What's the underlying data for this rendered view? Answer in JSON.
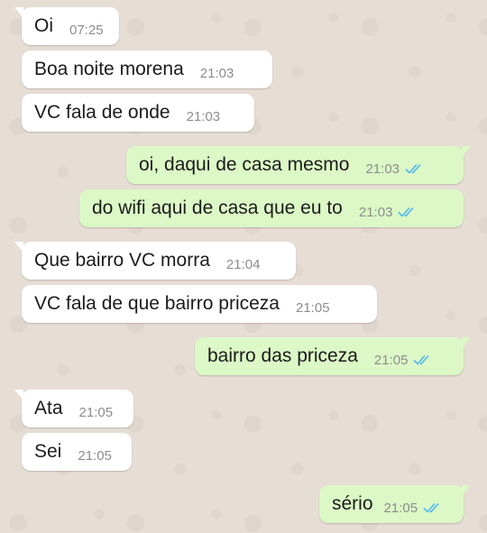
{
  "messages": [
    {
      "text": "Oi",
      "time": "07:25",
      "direction": "incoming"
    },
    {
      "text": "Boa noite morena",
      "time": "21:03",
      "direction": "incoming"
    },
    {
      "text": "VC fala de onde",
      "time": "21:03",
      "direction": "incoming"
    },
    {
      "text": "oi, daqui de casa mesmo",
      "time": "21:03",
      "direction": "outgoing",
      "status": "read"
    },
    {
      "text": "do wifi aqui de casa que eu to",
      "time": "21:03",
      "direction": "outgoing",
      "status": "read"
    },
    {
      "text": "Que bairro VC morra",
      "time": "21:04",
      "direction": "incoming"
    },
    {
      "text": "VC fala de que bairro priceza",
      "time": "21:05",
      "direction": "incoming"
    },
    {
      "text": "bairro das priceza",
      "time": "21:05",
      "direction": "outgoing",
      "status": "read"
    },
    {
      "text": "Ata",
      "time": "21:05",
      "direction": "incoming"
    },
    {
      "text": "Sei",
      "time": "21:05",
      "direction": "incoming"
    },
    {
      "text": "sério",
      "time": "21:05",
      "direction": "outgoing",
      "status": "read"
    }
  ],
  "colors": {
    "chat_background": "#e6ddd4",
    "incoming_bubble": "#ffffff",
    "outgoing_bubble": "#dcf8c6",
    "read_ticks": "#4fb6ec",
    "timestamp": "#8c8c8c"
  },
  "icons": {
    "read_receipt": "double-check-icon"
  }
}
